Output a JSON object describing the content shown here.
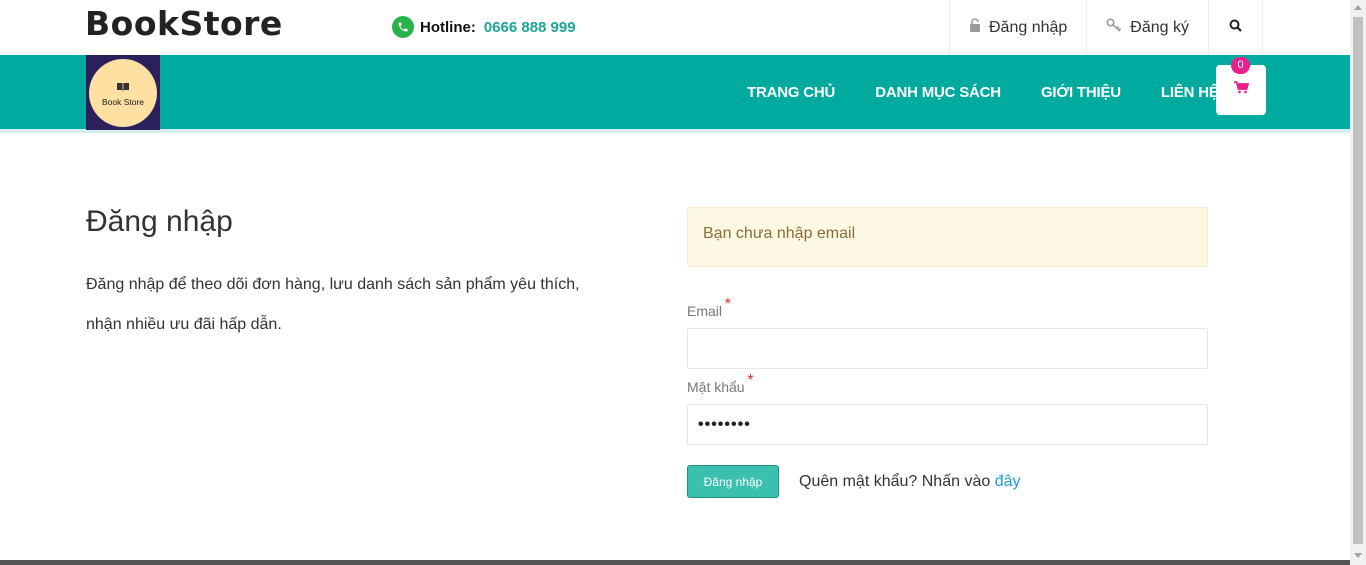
{
  "brand": {
    "name": "BookStore"
  },
  "hotline": {
    "label": "Hotline:",
    "number": "0666 888 999",
    "icon": "phone-icon"
  },
  "auth": {
    "login_label": "Đăng nhập",
    "register_label": "Đăng ký"
  },
  "logo": {
    "text": "Book Store"
  },
  "nav": {
    "items": [
      "TRANG CHỦ",
      "DANH MỤC SÁCH",
      "GIỚI THIỆU",
      "LIÊN HỆ"
    ],
    "cart_count": "0"
  },
  "intro": {
    "title": "Đăng nhập",
    "description": "Đăng nhập để theo dõi đơn hàng, lưu danh sách sản phẩm yêu thích, nhận nhiều ưu đãi hấp dẫn."
  },
  "form": {
    "alert": "Bạn chưa nhập email",
    "email_label": "Email",
    "email_value": "",
    "password_label": "Mật khẩu",
    "password_value": "••••••••",
    "required_mark": "*",
    "submit_label": "Đăng nhập",
    "forgot_text": "Quên mật khẩu? Nhấn vào",
    "forgot_link": "đây"
  },
  "colors": {
    "accent": "#00aa9e",
    "hotline": "#1aa597",
    "badge": "#ea1f8c",
    "link": "#1a9fd6"
  }
}
